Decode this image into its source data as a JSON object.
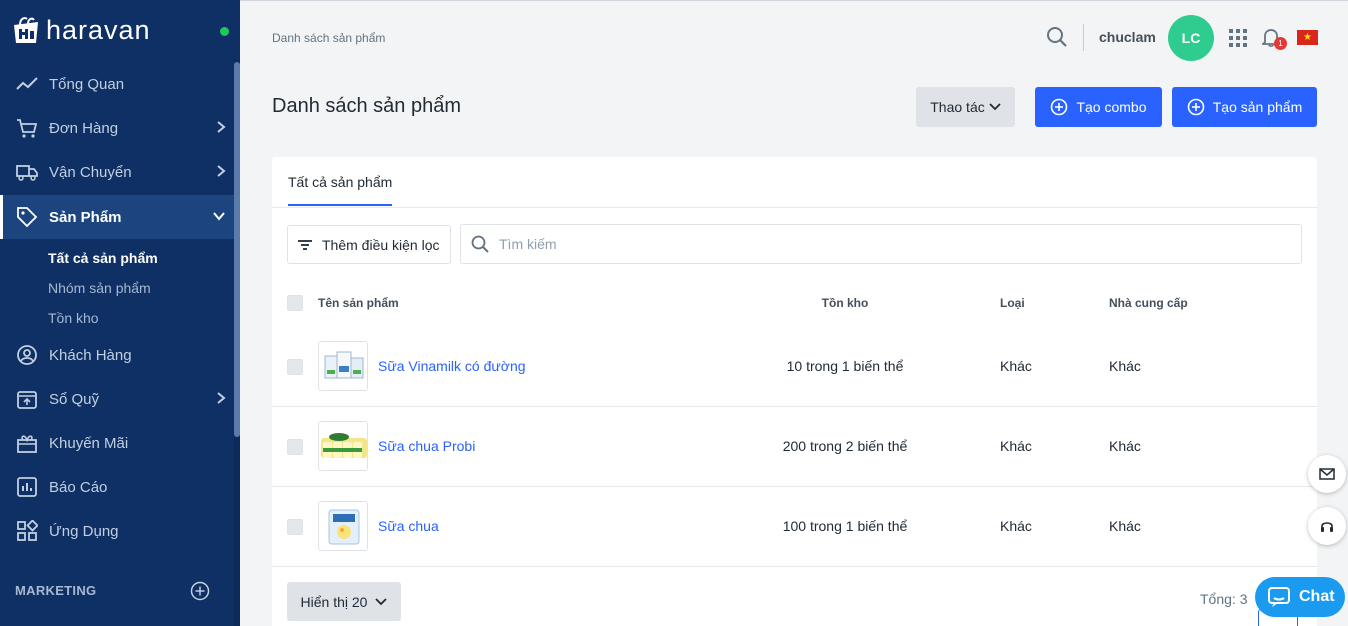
{
  "app": {
    "logo_text": "haravan"
  },
  "sidebar": {
    "items": [
      {
        "label": "Tổng Quan",
        "icon": "trend-icon"
      },
      {
        "label": "Đơn Hàng",
        "icon": "cart-icon"
      },
      {
        "label": "Vận Chuyển",
        "icon": "truck-icon"
      },
      {
        "label": "Sản Phẩm",
        "icon": "tag-icon"
      },
      {
        "label": "Khách Hàng",
        "icon": "user-circle-icon"
      },
      {
        "label": "Sổ Quỹ",
        "icon": "cashbox-icon"
      },
      {
        "label": "Khuyến Mãi",
        "icon": "gift-icon"
      },
      {
        "label": "Báo Cáo",
        "icon": "report-icon"
      },
      {
        "label": "Ứng Dụng",
        "icon": "apps-icon"
      }
    ],
    "subitems": [
      "Tất cả sản phẩm",
      "Nhóm sản phẩm",
      "Tồn kho"
    ],
    "section_label": "MARKETING"
  },
  "header": {
    "breadcrumb": "Danh sách sản phẩm",
    "username": "chuclam",
    "avatar_initials": "LC",
    "notification_count": "1"
  },
  "page": {
    "title": "Danh sách sản phẩm",
    "action_label": "Thao tác",
    "combo_label": "Tạo combo",
    "create_label": "Tạo sản phẩm"
  },
  "tabs": {
    "all_products": "Tất cả sản phẩm"
  },
  "filters": {
    "add_filter_label": "Thêm điều kiện lọc",
    "search_placeholder": "Tìm kiếm"
  },
  "table": {
    "headers": {
      "name": "Tên sản phẩm",
      "stock": "Tồn kho",
      "type": "Loại",
      "vendor": "Nhà cung cấp"
    },
    "rows": [
      {
        "name": "Sữa Vinamilk có đường",
        "stock": "10 trong 1 biến thể",
        "type": "Khác",
        "vendor": "Khác"
      },
      {
        "name": "Sữa chua Probi",
        "stock": "200 trong 2 biến thể",
        "type": "Khác",
        "vendor": "Khác"
      },
      {
        "name": "Sữa chua",
        "stock": "100 trong 1 biến thể",
        "type": "Khác",
        "vendor": "Khác"
      }
    ]
  },
  "pagination": {
    "page_size_label": "Hiển thị 20",
    "total_label": "Tổng: 3"
  },
  "chat": {
    "label": "Chat"
  },
  "colors": {
    "sidebar": "#0f3064",
    "primary": "#2962ff",
    "avatar": "#2ecc8e",
    "chat": "#1b9bf0"
  }
}
